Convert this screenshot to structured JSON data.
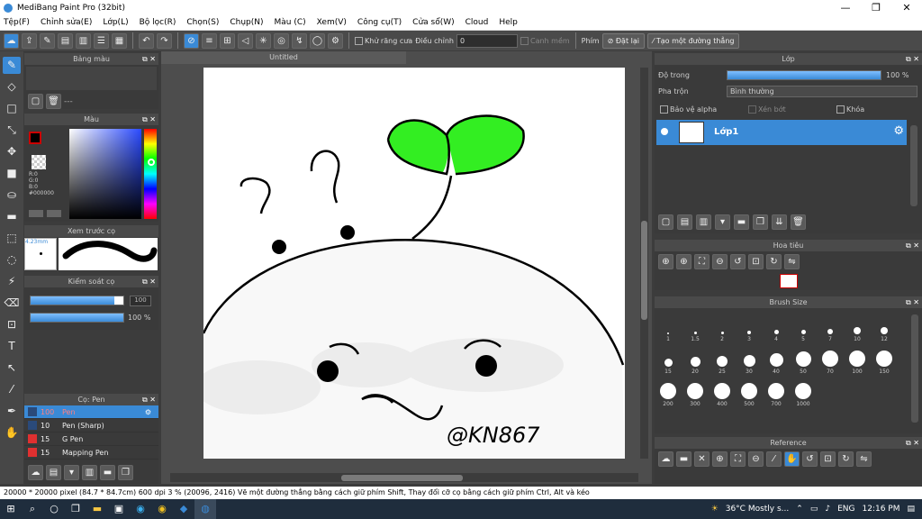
{
  "window": {
    "title": "MediBang Paint Pro (32bit)",
    "controls": [
      "—",
      "❐",
      "✕"
    ]
  },
  "menu": [
    "Tệp(F)",
    "Chỉnh sửa(E)",
    "Lớp(L)",
    "Bộ lọc(R)",
    "Chọn(S)",
    "Chụp(N)",
    "Màu (C)",
    "Xem(V)",
    "Công cụ(T)",
    "Cửa sổ(W)",
    "Cloud",
    "Help"
  ],
  "toolbar": {
    "antialias_label": "Khử răng cưa",
    "correction_label": "Điều chỉnh",
    "correction_value": "0",
    "snap_label": "Canh mềm",
    "key_label": "Phím",
    "reset_label": "Đặt lại",
    "line_label": "Tạo một đường thẳng"
  },
  "panels": {
    "palette_title": "Bảng màu",
    "palette_dash": "---",
    "color_title": "Màu",
    "color_readout": {
      "r": "R:0",
      "g": "G:0",
      "b": "B:0",
      "hex": "#000000"
    },
    "preview_title": "Xem trước cọ",
    "preview_size": "4.23mm",
    "brush_control_title": "Kiểm soát cọ",
    "size_value": "100",
    "opacity_value": "100 %",
    "brush_list_title": "Cọ: Pen",
    "brushes": [
      {
        "size": "100",
        "name": "Pen",
        "color": "#2a4a7a"
      },
      {
        "size": "10",
        "name": "Pen (Sharp)",
        "color": "#2a4a7a"
      },
      {
        "size": "15",
        "name": "G Pen",
        "color": "#e03030"
      },
      {
        "size": "15",
        "name": "Mapping Pen",
        "color": "#e03030"
      }
    ]
  },
  "canvas": {
    "tab_title": "Untitled",
    "signature": "@KN867"
  },
  "layer_panel": {
    "title": "Lớp",
    "opacity_label": "Độ trong",
    "opacity_value": "100 %",
    "blend_label": "Pha trộn",
    "blend_value": "Bình thường",
    "protect_alpha": "Bảo vệ alpha",
    "clipping": "Xén bớt",
    "lock": "Khóa",
    "layer_name": "Lớp1"
  },
  "navigator_title": "Hoa tiêu",
  "brush_size": {
    "title": "Brush Size",
    "sizes": [
      "1",
      "1.5",
      "2",
      "3",
      "4",
      "5",
      "7",
      "10",
      "12",
      "15",
      "20",
      "25",
      "30",
      "40",
      "50",
      "70",
      "100",
      "150",
      "200",
      "300",
      "400",
      "500",
      "700",
      "1000"
    ]
  },
  "reference_title": "Reference",
  "status": "20000 * 20000 pixel  (84.7 * 84.7cm)  600 dpi  3 %  (20096, 2416)  Vẽ một đường thẳng bằng cách giữ phím Shift, Thay đổi cỡ cọ bằng cách giữ phím Ctrl, Alt và kéo",
  "taskbar": {
    "weather": "36°C  Mostly s...",
    "lang": "ENG",
    "time": "12:16 PM"
  }
}
